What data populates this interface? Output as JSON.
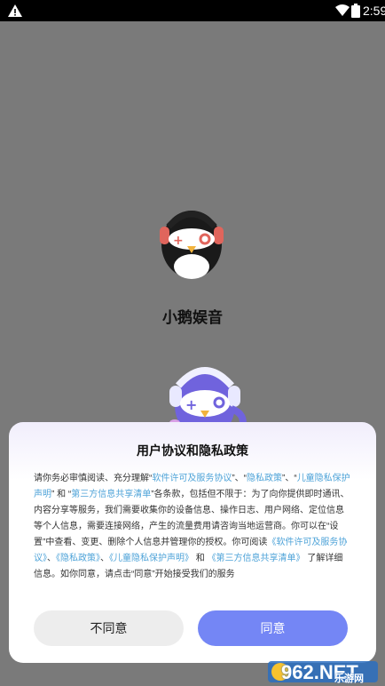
{
  "status_bar": {
    "time": "2:59",
    "icons": [
      "warning-icon",
      "wifi-icon",
      "battery-icon"
    ]
  },
  "app": {
    "name": "小鹅娱音"
  },
  "dialog": {
    "title": "用户协议和隐私政策",
    "body_segments": [
      {
        "text": "请你务必审慎阅读、充分理解“",
        "link": false
      },
      {
        "text": "软件许可及服务协议",
        "link": true
      },
      {
        "text": "”、“",
        "link": false
      },
      {
        "text": "隐私政策",
        "link": true
      },
      {
        "text": "”、“",
        "link": false
      },
      {
        "text": "儿童隐私保护声明",
        "link": true
      },
      {
        "text": "” 和 “",
        "link": false
      },
      {
        "text": "第三方信息共享清单",
        "link": true
      },
      {
        "text": "”各条款，包括但不限于：为了向你提供即时通讯、内容分享等服务，我们需要收集你的设备信息、操作日志、用户网络、定位信息等个人信息，需要连接网络，产生的流量费用请咨询当地运营商。你可以在“设置”中查看、变更、删除个人信息并管理你的授权。你可阅读",
        "link": false
      },
      {
        "text": "《软件许可及服务协议》",
        "link": true
      },
      {
        "text": "、",
        "link": false
      },
      {
        "text": "《隐私政策》",
        "link": true
      },
      {
        "text": "、",
        "link": false
      },
      {
        "text": "《儿童隐私保护声明》",
        "link": true
      },
      {
        "text": " 和 ",
        "link": false
      },
      {
        "text": "《第三方信息共享清单》",
        "link": true
      },
      {
        "text": " 了解详细信息。如你同意，请点击“同意”开始接受我们的服务",
        "link": false
      }
    ],
    "decline_label": "不同意",
    "agree_label": "同意"
  },
  "watermark": {
    "brand": "962.NET",
    "sub": "乐游网"
  },
  "colors": {
    "overlay": "#7a7a7a",
    "link": "#4ea3d8",
    "agree_button": "#7486f5",
    "decline_button": "#ededed"
  }
}
